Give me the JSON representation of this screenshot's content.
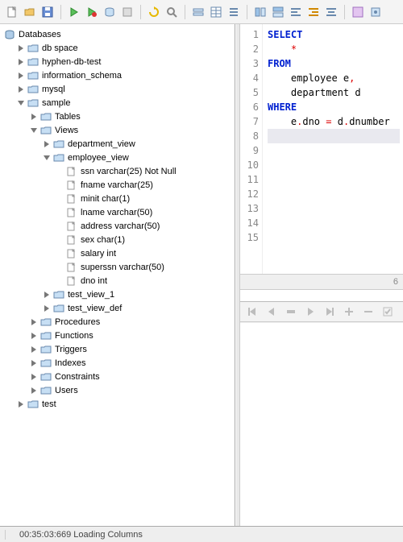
{
  "toolbar": {
    "buttons": [
      "new",
      "open",
      "save",
      "sep",
      "exec",
      "exec-red",
      "exec-db",
      "stop",
      "sep",
      "refresh",
      "find",
      "sep",
      "copy-row",
      "copy-table",
      "list",
      "sep",
      "align1",
      "align2",
      "align3",
      "align4",
      "align5",
      "sep",
      "format",
      "options"
    ]
  },
  "tree": {
    "root": "Databases",
    "items": [
      {
        "lv": 1,
        "exp": "closed",
        "icon": "folder",
        "label": "db space"
      },
      {
        "lv": 1,
        "exp": "closed",
        "icon": "folder",
        "label": "hyphen-db-test"
      },
      {
        "lv": 1,
        "exp": "closed",
        "icon": "folder",
        "label": "information_schema"
      },
      {
        "lv": 1,
        "exp": "closed",
        "icon": "folder",
        "label": "mysql"
      },
      {
        "lv": 1,
        "exp": "open",
        "icon": "folder",
        "label": "sample"
      },
      {
        "lv": 2,
        "exp": "closed",
        "icon": "folder",
        "label": "Tables"
      },
      {
        "lv": 2,
        "exp": "open",
        "icon": "folder",
        "label": "Views"
      },
      {
        "lv": 3,
        "exp": "closed",
        "icon": "folder",
        "label": "department_view"
      },
      {
        "lv": 3,
        "exp": "open",
        "icon": "folder",
        "label": "employee_view"
      },
      {
        "lv": 4,
        "exp": "none",
        "icon": "col",
        "label": "ssn varchar(25) Not Null"
      },
      {
        "lv": 4,
        "exp": "none",
        "icon": "col",
        "label": "fname varchar(25)"
      },
      {
        "lv": 4,
        "exp": "none",
        "icon": "col",
        "label": "minit char(1)"
      },
      {
        "lv": 4,
        "exp": "none",
        "icon": "col",
        "label": "lname varchar(50)"
      },
      {
        "lv": 4,
        "exp": "none",
        "icon": "col",
        "label": "address varchar(50)"
      },
      {
        "lv": 4,
        "exp": "none",
        "icon": "col",
        "label": "sex char(1)"
      },
      {
        "lv": 4,
        "exp": "none",
        "icon": "col",
        "label": "salary int"
      },
      {
        "lv": 4,
        "exp": "none",
        "icon": "col",
        "label": "superssn varchar(50)"
      },
      {
        "lv": 4,
        "exp": "none",
        "icon": "col",
        "label": "dno int"
      },
      {
        "lv": 3,
        "exp": "closed",
        "icon": "folder",
        "label": "test_view_1"
      },
      {
        "lv": 3,
        "exp": "closed",
        "icon": "folder",
        "label": "test_view_def"
      },
      {
        "lv": 2,
        "exp": "closed",
        "icon": "folder",
        "label": "Procedures"
      },
      {
        "lv": 2,
        "exp": "closed",
        "icon": "folder",
        "label": "Functions"
      },
      {
        "lv": 2,
        "exp": "closed",
        "icon": "folder",
        "label": "Triggers"
      },
      {
        "lv": 2,
        "exp": "closed",
        "icon": "folder",
        "label": "Indexes"
      },
      {
        "lv": 2,
        "exp": "closed",
        "icon": "folder",
        "label": "Constraints"
      },
      {
        "lv": 2,
        "exp": "closed",
        "icon": "folder",
        "label": "Users"
      },
      {
        "lv": 1,
        "exp": "closed",
        "icon": "folder",
        "label": "test"
      }
    ]
  },
  "editor": {
    "lines": [
      {
        "n": 1,
        "tokens": [
          {
            "t": "SELECT",
            "c": "kw"
          }
        ]
      },
      {
        "n": 2,
        "tokens": [
          {
            "t": "    ",
            "c": "pn"
          },
          {
            "t": "*",
            "c": "str"
          }
        ]
      },
      {
        "n": 3,
        "tokens": [
          {
            "t": "FROM",
            "c": "kw"
          }
        ]
      },
      {
        "n": 4,
        "tokens": [
          {
            "t": "    employee e",
            "c": "pn"
          },
          {
            "t": ",",
            "c": "str"
          }
        ]
      },
      {
        "n": 5,
        "tokens": [
          {
            "t": "    department d",
            "c": "pn"
          }
        ]
      },
      {
        "n": 6,
        "tokens": [
          {
            "t": "WHERE",
            "c": "kw"
          }
        ]
      },
      {
        "n": 7,
        "tokens": [
          {
            "t": "    e",
            "c": "pn"
          },
          {
            "t": ".",
            "c": "str"
          },
          {
            "t": "dno ",
            "c": "pn"
          },
          {
            "t": "=",
            "c": "str"
          },
          {
            "t": " d",
            "c": "pn"
          },
          {
            "t": ".",
            "c": "str"
          },
          {
            "t": "dnumber",
            "c": "pn"
          }
        ]
      },
      {
        "n": 8,
        "tokens": [],
        "current": true
      },
      {
        "n": 9,
        "tokens": []
      },
      {
        "n": 10,
        "tokens": []
      },
      {
        "n": 11,
        "tokens": []
      },
      {
        "n": 12,
        "tokens": []
      },
      {
        "n": 13,
        "tokens": []
      },
      {
        "n": 14,
        "tokens": []
      },
      {
        "n": 15,
        "tokens": []
      }
    ],
    "hscroll_right": "6"
  },
  "midToolbar": {
    "buttons": [
      "first",
      "prev",
      "row",
      "next",
      "last",
      "add",
      "del",
      "commit"
    ]
  },
  "status": {
    "text": "00:35:03:669 Loading Columns"
  }
}
